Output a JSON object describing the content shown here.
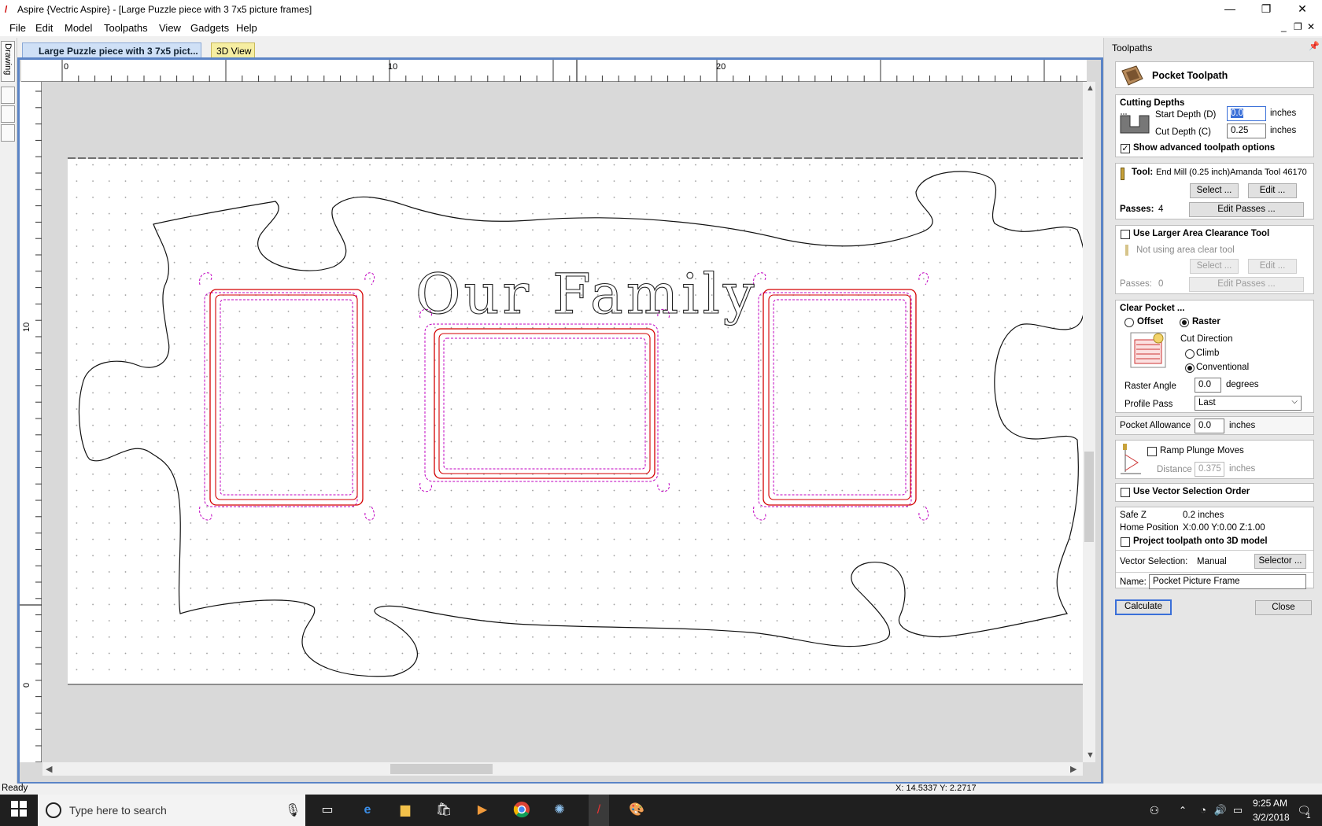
{
  "window": {
    "title": "Aspire {Vectric Aspire} - [Large Puzzle piece with 3 7x5 picture frames]",
    "controls": {
      "minimize": "—",
      "maximize": "❐",
      "close": "✕"
    },
    "mdi_controls": {
      "minimize": "_",
      "restore": "❐",
      "close": "✕"
    }
  },
  "menu": {
    "items": [
      "File",
      "Edit",
      "Model",
      "Toolpaths",
      "View",
      "Gadgets",
      "Help"
    ]
  },
  "left_strip": {
    "drawing_tab": "Drawing"
  },
  "doc_tabs": {
    "active": "Large Puzzle piece with 3 7x5 pict...",
    "view3d": "3D View"
  },
  "rulers": {
    "h_labels": [
      "0",
      "10",
      "20"
    ],
    "v_labels": [
      "10",
      "0"
    ]
  },
  "design": {
    "title_text": "Our Family",
    "frames": [
      "left-frame",
      "center-frame",
      "right-frame"
    ]
  },
  "panel": {
    "title": "Toolpaths",
    "heading": "Pocket Toolpath",
    "cutting_depths": {
      "label": "Cutting Depths",
      "start_label": "Start Depth (D)",
      "start_value": "0.0",
      "cut_label": "Cut Depth (C)",
      "cut_value": "0.25",
      "unit": "inches"
    },
    "advanced": {
      "label": "Show advanced toolpath options",
      "checked": true
    },
    "tool": {
      "label": "Tool:",
      "value": "End Mill (0.25 inch)Amanda Tool 46170",
      "select": "Select ...",
      "edit": "Edit ...",
      "passes_label": "Passes:",
      "passes_value": "4",
      "edit_passes": "Edit Passes ..."
    },
    "clearance": {
      "label": "Use Larger Area Clearance Tool",
      "checked": false,
      "note": "Not using area clear tool",
      "select": "Select ...",
      "edit": "Edit ...",
      "passes_label": "Passes:",
      "passes_value": "0",
      "edit_passes": "Edit Passes ..."
    },
    "clear_pocket": {
      "label": "Clear Pocket ...",
      "offset": "Offset",
      "raster": "Raster",
      "selected": "Raster",
      "cut_direction": "Cut Direction",
      "climb": "Climb",
      "conventional": "Conventional",
      "direction_selected": "Conventional",
      "raster_angle_label": "Raster Angle",
      "raster_angle_value": "0.0",
      "raster_angle_unit": "degrees",
      "profile_pass_label": "Profile Pass",
      "profile_pass_value": "Last"
    },
    "pocket_allowance": {
      "label": "Pocket Allowance",
      "value": "0.0",
      "unit": "inches"
    },
    "ramp": {
      "label": "Ramp Plunge Moves",
      "checked": false,
      "distance_label": "Distance",
      "distance_value": "0.375",
      "unit": "inches"
    },
    "vector_order": {
      "label": "Use Vector Selection Order",
      "checked": false
    },
    "safe_z": {
      "label": "Safe Z",
      "value": "0.2 inches"
    },
    "home": {
      "label": "Home Position",
      "value": "X:0.00 Y:0.00 Z:1.00"
    },
    "project": {
      "label": "Project toolpath onto 3D model",
      "checked": false
    },
    "vector_selection": {
      "label": "Vector Selection:",
      "value": "Manual",
      "button": "Selector ..."
    },
    "name": {
      "label": "Name:",
      "value": "Pocket Picture Frame"
    },
    "calculate": "Calculate",
    "close": "Close"
  },
  "status": {
    "left": "Ready",
    "coords": "X: 14.5337 Y:  2.2717"
  },
  "taskbar": {
    "search_placeholder": "Type here to search",
    "time": "9:25 AM",
    "date": "3/2/2018",
    "notif_count": "1"
  },
  "colors": {
    "frame_blue": "#5b84c6",
    "pocket_red": "#d40000",
    "offset_magenta": "#c000c0",
    "taskbar": "#1f1f1f"
  }
}
